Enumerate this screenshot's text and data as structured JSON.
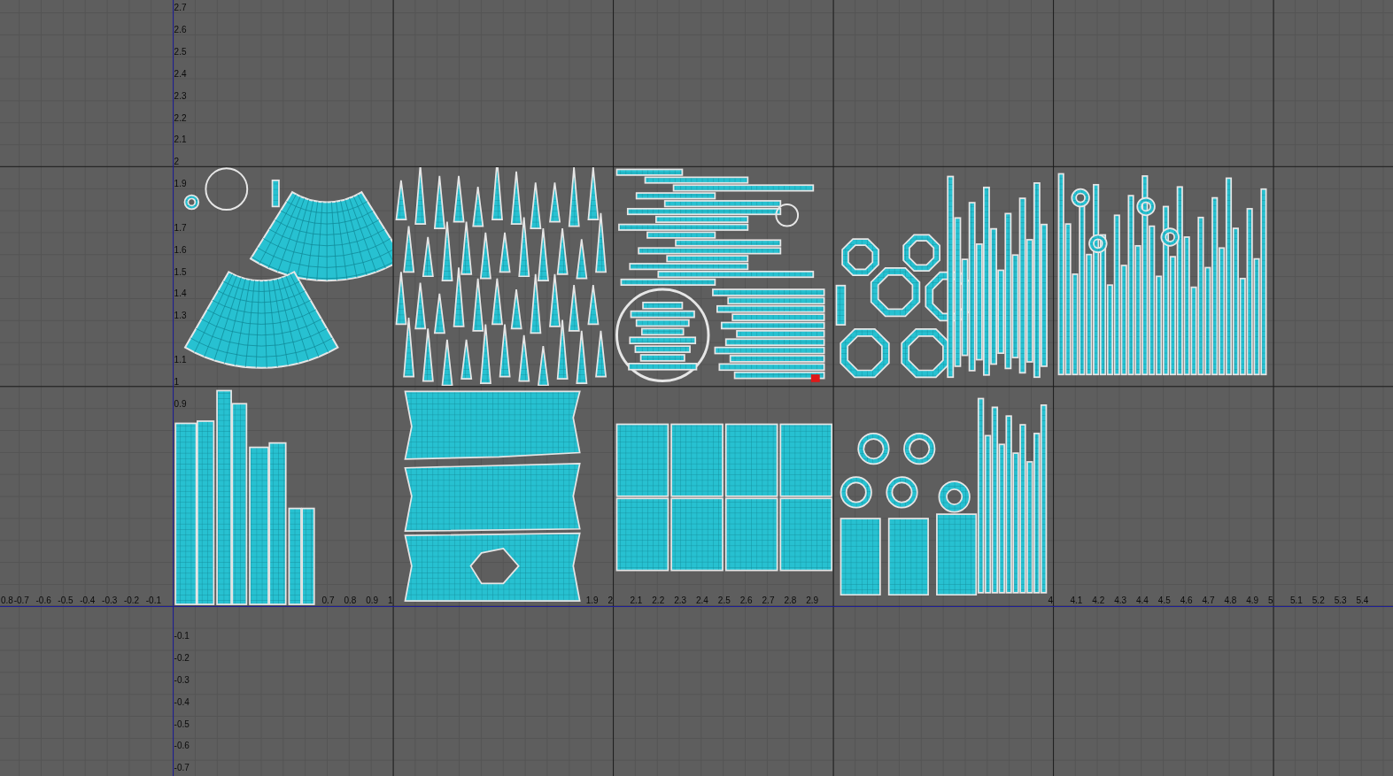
{
  "uv_editor": {
    "x_axis": {
      "label_runs": [
        [
          "0.8",
          "-0.7",
          "-0.6",
          "-0.5",
          "-0.4",
          "-0.3",
          "-0.2",
          "-0.1"
        ],
        [
          "0.7",
          "0.8",
          "0.9",
          "1"
        ],
        [
          "1.9",
          "2",
          "2.1",
          "2.2",
          "2.3",
          "2.4",
          "2.5",
          "2.6",
          "2.7",
          "2.8",
          "2.9"
        ],
        [
          "4",
          "4.1",
          "4.2",
          "4.3",
          "4.4",
          "4.5",
          "4.6",
          "4.7",
          "4.8",
          "4.9",
          "5",
          "5.1",
          "5.2",
          "5.3",
          "5.4"
        ]
      ]
    },
    "y_axis": {
      "label_runs": [
        [
          "2.7",
          "2.6",
          "2.5",
          "2.4",
          "2.3",
          "2.2",
          "2.1",
          "2"
        ],
        [
          "1.9"
        ],
        [
          "1.7",
          "1.6",
          "1.5",
          "1.4",
          "1.3"
        ],
        [
          "1.1",
          "1"
        ],
        [
          "0.9"
        ],
        [
          "-0.1",
          "-0.2",
          "-0.3",
          "-0.4",
          "-0.5",
          "-0.6",
          "-0.7"
        ]
      ]
    },
    "tile_rows": [
      [
        {
          "kind": "fans"
        },
        {
          "kind": "spikes"
        },
        {
          "kind": "bars"
        },
        {
          "kind": "rings"
        },
        {
          "kind": "columns"
        }
      ],
      [
        {
          "kind": "tall_bars"
        },
        {
          "kind": "cloth"
        },
        {
          "kind": "panels"
        },
        {
          "kind": "mixed"
        }
      ]
    ]
  }
}
